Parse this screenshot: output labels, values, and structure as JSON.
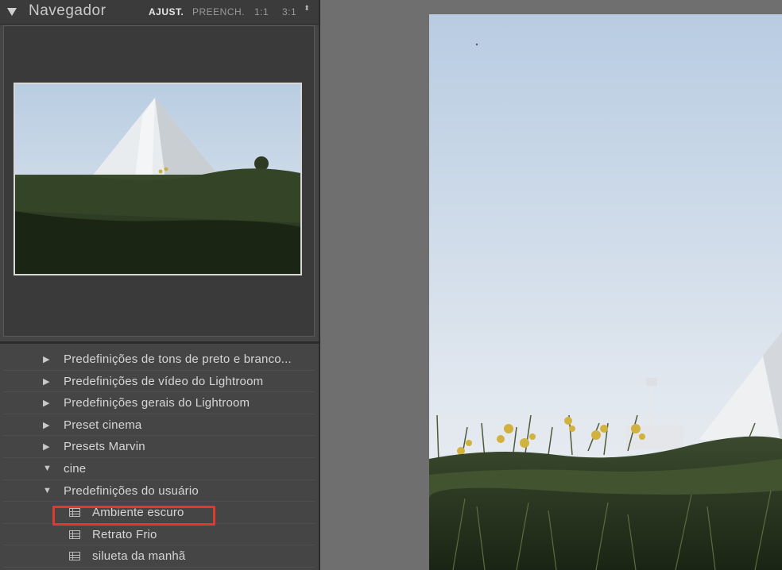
{
  "navigator": {
    "title": "Navegador",
    "zoom_options": [
      "AJUST.",
      "PREENCH.",
      "1:1",
      "3:1"
    ],
    "active_zoom": "AJUST.",
    "stepper_symbol": "⬍"
  },
  "presets": [
    {
      "label": "Predefinições de tons de preto e branco...",
      "arrow": "▶",
      "type": "folder",
      "expanded": false
    },
    {
      "label": "Predefinições de vídeo do Lightroom",
      "arrow": "▶",
      "type": "folder",
      "expanded": false
    },
    {
      "label": "Predefinições gerais do Lightroom",
      "arrow": "▶",
      "type": "folder",
      "expanded": false
    },
    {
      "label": "Preset cinema",
      "arrow": "▶",
      "type": "folder",
      "expanded": false
    },
    {
      "label": "Presets Marvin",
      "arrow": "▶",
      "type": "folder",
      "expanded": false
    },
    {
      "label": "cine",
      "arrow": "▼",
      "type": "folder",
      "expanded": true
    },
    {
      "label": "Predefinições do usuário",
      "arrow": "▼",
      "type": "folder",
      "expanded": true
    },
    {
      "label": "Ambiente escuro",
      "type": "preset",
      "highlighted": true
    },
    {
      "label": "Retrato Frio",
      "type": "preset"
    },
    {
      "label": "silueta da manhã",
      "type": "preset"
    }
  ],
  "colors": {
    "highlight": "#e03a2a",
    "panel_bg": "#454545",
    "canvas_bg": "#6f6f6f"
  }
}
